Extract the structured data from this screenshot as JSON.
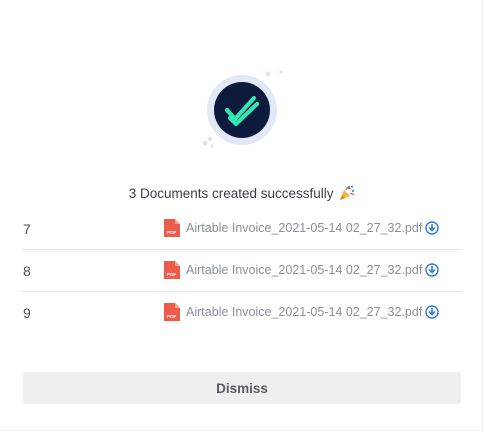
{
  "status": {
    "message": "3 Documents created successfully",
    "emoji_icon": "party-popper-icon",
    "check_icon": "double-check-icon",
    "colors": {
      "check_circle": "#0f1b3d",
      "check_mark": "#34e6b0",
      "halo": "#e2e8f5"
    }
  },
  "documents": [
    {
      "number": "7",
      "file_name": "Airtable Invoice_2021-05-14 02_27_32.pdf",
      "file_icon": "pdf-file-icon",
      "action_icon": "download-icon"
    },
    {
      "number": "8",
      "file_name": "Airtable Invoice_2021-05-14 02_27_32.pdf",
      "file_icon": "pdf-file-icon",
      "action_icon": "download-icon"
    },
    {
      "number": "9",
      "file_name": "Airtable Invoice_2021-05-14 02_27_32.pdf",
      "file_icon": "pdf-file-icon",
      "action_icon": "download-icon"
    }
  ],
  "actions": {
    "dismiss_label": "Dismiss"
  },
  "colors": {
    "accent_link": "#2f74e8",
    "pdf_red": "#ef5b4a"
  }
}
